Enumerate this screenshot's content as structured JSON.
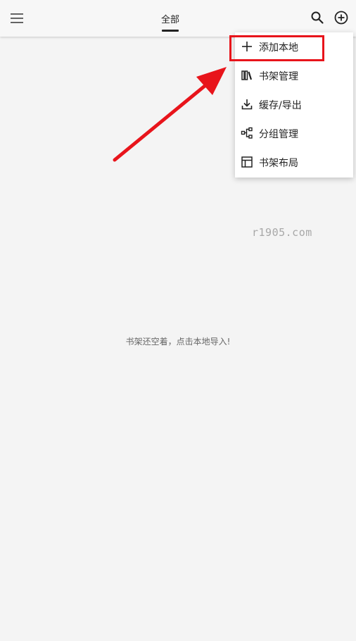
{
  "header": {
    "menu_icon": "hamburger-menu-icon",
    "tab_label": "全部",
    "search_icon": "search-icon",
    "add_icon": "add-circle-icon"
  },
  "popup_menu": {
    "items": [
      {
        "label": "添加本地",
        "icon": "plus-icon"
      },
      {
        "label": "书架管理",
        "icon": "bookshelf-icon"
      },
      {
        "label": "缓存/导出",
        "icon": "download-icon"
      },
      {
        "label": "分组管理",
        "icon": "group-tree-icon"
      },
      {
        "label": "书架布局",
        "icon": "layout-icon"
      }
    ]
  },
  "annotation": {
    "highlight_color": "#e8141b",
    "arrow_color": "#e8141b"
  },
  "watermark": "r1905.com",
  "empty_hint": "书架还空着，点击本地导入!"
}
